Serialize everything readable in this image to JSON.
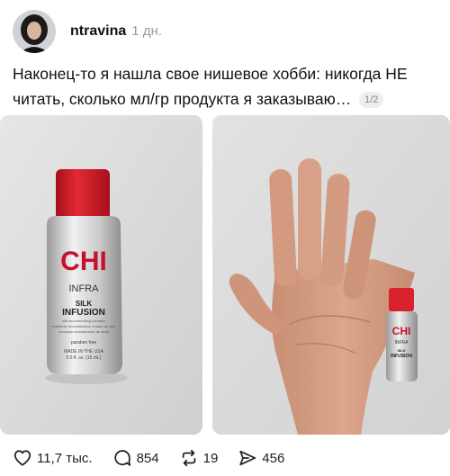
{
  "post": {
    "username": "ntravina",
    "time": "1 дн.",
    "text": "Наконец-то я нашла свое нишевое хобби: никогда НЕ читать, сколько мл/гр продукта я заказываю…",
    "media_counter": "1/2"
  },
  "product": {
    "brand": "CHI",
    "line1": "INFRA",
    "line2": "SILK",
    "line3": "INFUSION",
    "small1": "silk reconstructing complex",
    "small2": "complexe reconstructeur à base de soie",
    "small3": "complejo reconstructor de seda",
    "free": "paraben free",
    "made": "MADE IN THE USA",
    "volume": "0.5 fl. oz. (15 mL)"
  },
  "actions": {
    "likes": "11,7 тыс.",
    "replies": "854",
    "reposts": "19",
    "shares": "456"
  },
  "colors": {
    "cap_red": "#d8232f",
    "brand_red": "#c8102e",
    "icon": "#222222"
  }
}
